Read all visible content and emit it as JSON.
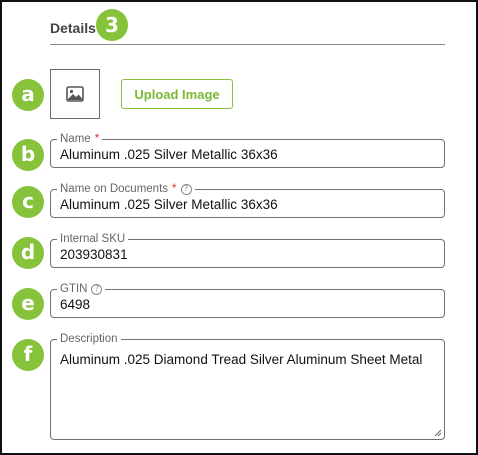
{
  "section": {
    "title": "Details",
    "step_number": "3"
  },
  "image_upload": {
    "placeholder_icon": "image-icon",
    "button_label": "Upload Image"
  },
  "markers": [
    "a",
    "b",
    "c",
    "d",
    "e",
    "f"
  ],
  "fields": {
    "name": {
      "label": "Name",
      "required_mark": "*",
      "value": "Aluminum .025 Silver Metallic 36x36"
    },
    "name_on_documents": {
      "label": "Name on Documents",
      "required_mark": "*",
      "help": "?",
      "value": "Aluminum .025 Silver Metallic 36x36"
    },
    "internal_sku": {
      "label": "Internal SKU",
      "value": "203930831"
    },
    "gtin": {
      "label": "GTIN",
      "help": "?",
      "value": "6498"
    },
    "description": {
      "label": "Description",
      "value": "Aluminum .025 Diamond Tread Silver Aluminum Sheet Metal"
    }
  },
  "colors": {
    "accent": "#86c23a",
    "required": "#d93025",
    "border": "#6f6f6f"
  }
}
